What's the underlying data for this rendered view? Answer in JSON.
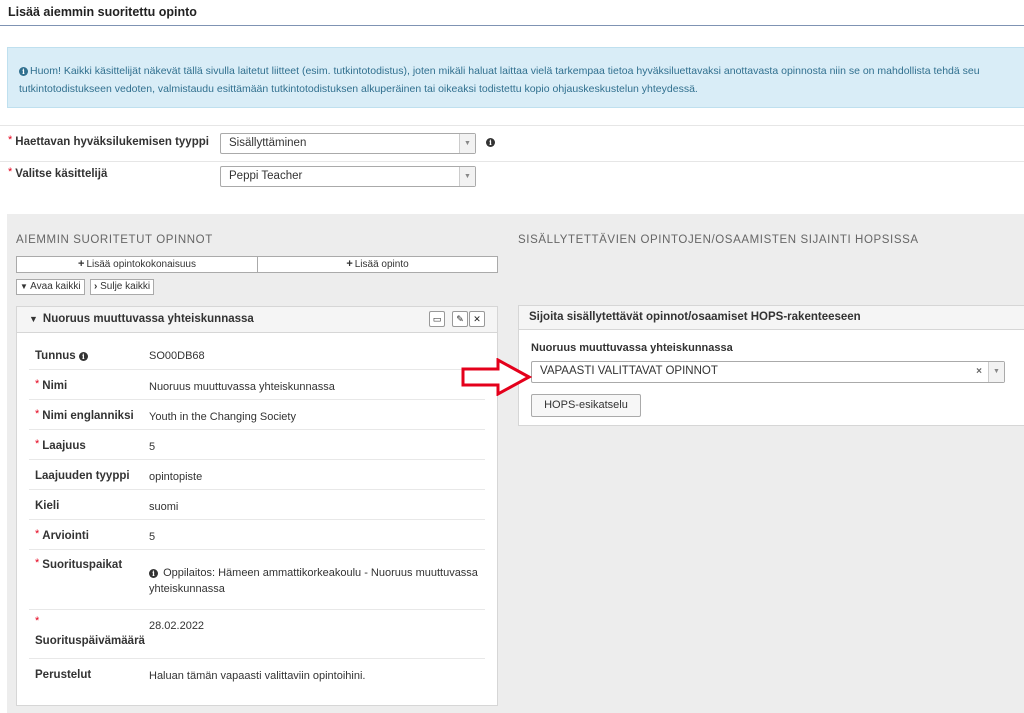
{
  "page": {
    "title": "Lisää aiemmin suoritettu opinto"
  },
  "notice": {
    "line1": "Huom! Kaikki käsittelijät näkevät tällä sivulla laitetut liitteet (esim. tutkintotodistus), joten mikäli haluat laittaa vielä tarkempaa tietoa hyväksiluettavaksi anottavasta opinnosta niin se on mahdollista tehdä seu",
    "line2": "tutkintotodistukseen vedoten, valmistaudu esittämään tutkintotodistuksen alkuperäinen tai oikeaksi todistettu kopio ohjauskeskustelun yhteydessä."
  },
  "form": {
    "type_label": "Haettavan hyväksilukemisen tyyppi",
    "type_value": "Sisällyttäminen",
    "handler_label": "Valitse käsittelijä",
    "handler_value": "Peppi Teacher",
    "required_mark": "*"
  },
  "left": {
    "heading": "AIEMMIN SUORITETUT OPINNOT",
    "add_module": "Lisää opintokokonaisuus",
    "add_course": "Lisää opinto",
    "open_all": "Avaa kaikki",
    "close_all": "Sulje kaikki",
    "card": {
      "title": "Nuoruus muuttuvassa yhteiskunnassa",
      "rows": [
        {
          "label": "Tunnus",
          "value": "SO00DB68",
          "required": false,
          "help": true
        },
        {
          "label": "Nimi",
          "value": "Nuoruus muuttuvassa yhteiskunnassa",
          "required": true
        },
        {
          "label": "Nimi englanniksi",
          "value": "Youth in the Changing Society",
          "required": true
        },
        {
          "label": "Laajuus",
          "value": "5",
          "required": true
        },
        {
          "label": "Laajuuden tyyppi",
          "value": "opintopiste",
          "required": false
        },
        {
          "label": "Kieli",
          "value": "suomi",
          "required": false
        },
        {
          "label": "Arviointi",
          "value": "5",
          "required": true
        },
        {
          "label": "Suorituspaikat",
          "value": "Oppilaitos: Hämeen ammattikorkeakoulu - Nuoruus muuttuvassa yhteiskunnassa",
          "required": true
        },
        {
          "label": "Suorituspäivämäärä",
          "value": "28.02.2022",
          "required": true
        },
        {
          "label": "Perustelut",
          "value": "Haluan tämän vapaasti valittaviin opintoihini.",
          "required": false
        }
      ]
    }
  },
  "right": {
    "heading": "SISÄLLYTETTÄVIEN OPINTOJEN/OSAAMISTEN SIJAINTI HOPSISSA",
    "box_title": "Sijoita sisällytettävät opinnot/osaamiset HOPS-rakenteeseen",
    "course_label": "Nuoruus muuttuvassa yhteiskunnassa",
    "placement_value": "VAPAASTI VALITTAVAT OPINNOT",
    "preview_button": "HOPS-esikatselu"
  },
  "colors": {
    "arrow": "#e4001b",
    "info_bg": "#d9edf7",
    "info_text": "#31708f"
  },
  "icons": [
    "info-circle-icon",
    "plus-icon",
    "chevron-down-icon",
    "chevron-right-icon",
    "folder-icon",
    "pencil-icon",
    "close-icon",
    "clear-x-icon",
    "dropdown-caret-icon",
    "red-arrow-annotation"
  ]
}
